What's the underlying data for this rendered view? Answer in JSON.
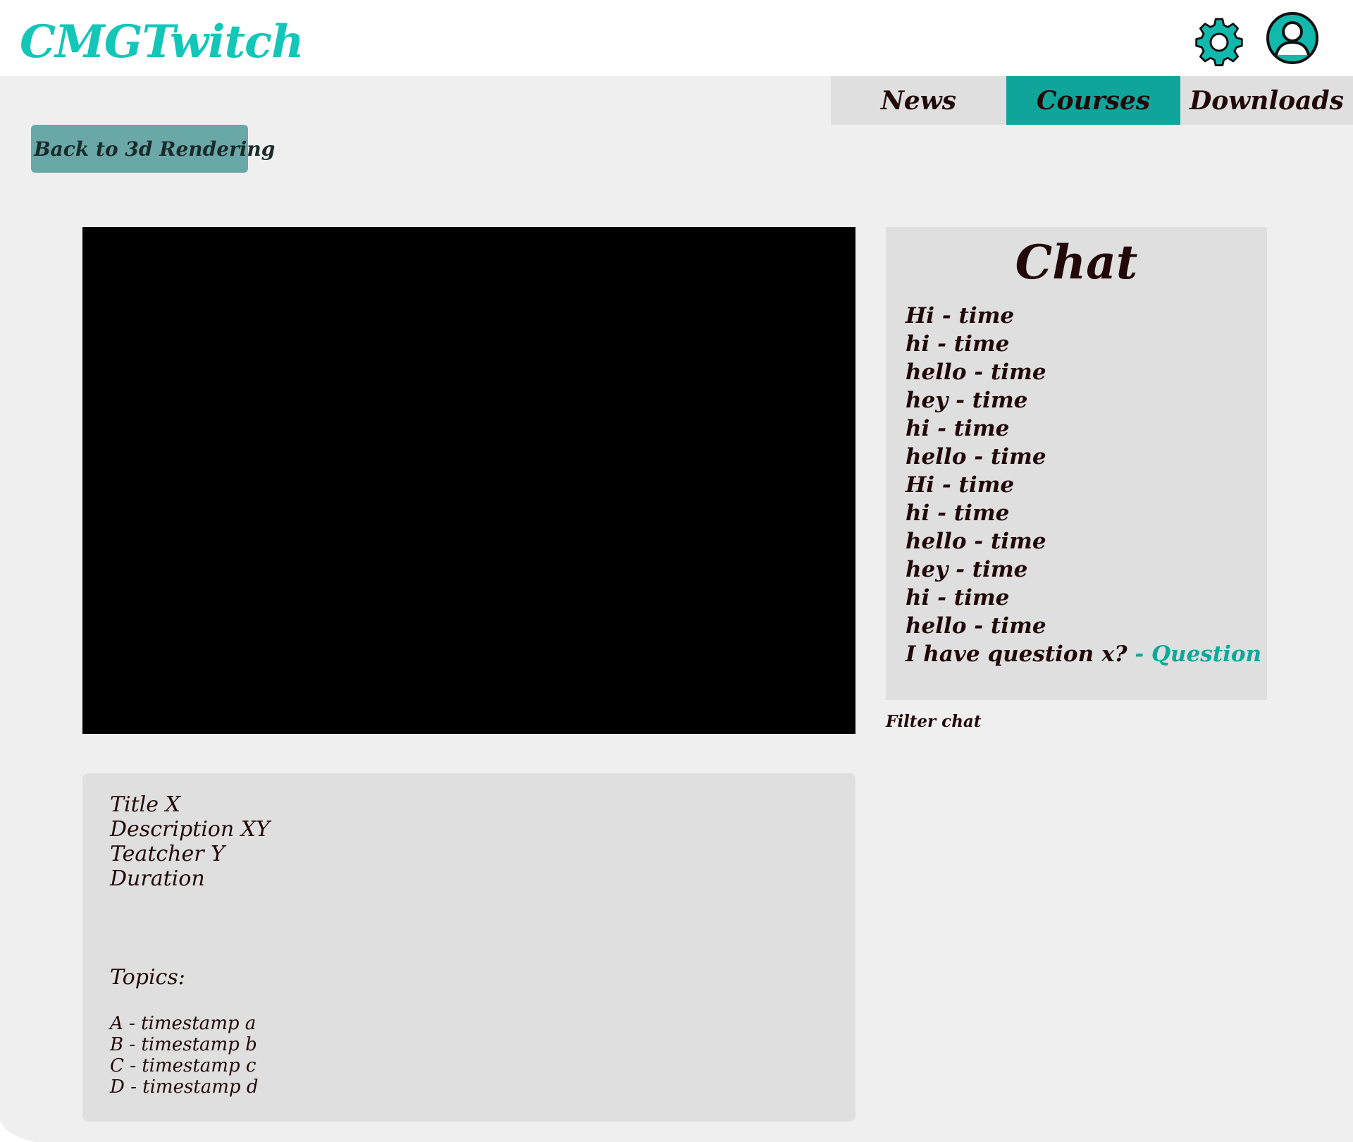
{
  "header": {
    "logo": "CMGTwitch",
    "settings_icon": "gear-icon",
    "profile_icon": "user-avatar-icon"
  },
  "nav": {
    "items": [
      {
        "label": "News",
        "active": false
      },
      {
        "label": "Courses",
        "active": true
      },
      {
        "label": "Downloads",
        "active": false
      }
    ]
  },
  "back_button": {
    "label": "Back to 3d Rendering"
  },
  "chat": {
    "title": "Chat",
    "messages": [
      "Hi - time",
      "hi - time",
      "hello - time",
      "hey - time",
      "hi - time",
      "hello - time",
      "Hi - time",
      "hi - time",
      "hello - time",
      "hey - time",
      "hi - time",
      "hello - time"
    ],
    "question_message": {
      "text": "I have question x?",
      "tag": " - Question"
    },
    "filter_label": "Filter chat"
  },
  "info": {
    "title": "Title X",
    "description": "Description XY",
    "teacher": "Teatcher Y",
    "duration": "Duration",
    "topics_label": "Topics:",
    "topics": [
      "A - timestamp a",
      "B - timestamp b",
      "C - timestamp c",
      "D - timestamp d"
    ]
  },
  "colors": {
    "accent": "#12c6b8",
    "nav_active": "#0fa59b",
    "back_button": "#6aa8a8",
    "panel": "#dfdfdf",
    "background": "#efefef",
    "text": "#220808"
  }
}
